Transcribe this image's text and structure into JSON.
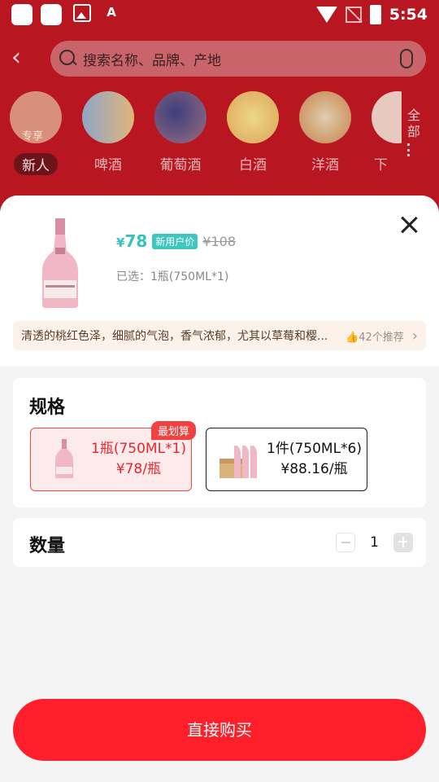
{
  "status_bar": {
    "time": "5:54"
  },
  "search": {
    "placeholder": "搜索名称、品牌、产地"
  },
  "categories": {
    "items": [
      {
        "label": "新人",
        "overlay": "专享",
        "active": true
      },
      {
        "label": "啤酒"
      },
      {
        "label": "葡萄酒"
      },
      {
        "label": "白酒"
      },
      {
        "label": "洋酒"
      },
      {
        "label": "下"
      }
    ],
    "all_label": "全部"
  },
  "sheet": {
    "price_symbol": "¥",
    "price_now": "78",
    "price_tag": "新用户价",
    "price_old": "¥108",
    "selected": "已选：1瓶(750ML*1)",
    "description": "清透的桃红色泽，细腻的气泡，香气浓郁，尤其以草莓和樱...",
    "recommend": "42个推荐",
    "spec_title": "规格",
    "best_badge": "最划算",
    "options": [
      {
        "name": "1瓶(750ML*1)",
        "price": "¥78/瓶",
        "selected": true
      },
      {
        "name": "1件(750ML*6)",
        "price": "¥88.16/瓶",
        "selected": false
      }
    ],
    "qty_title": "数量",
    "qty_value": "1",
    "buy_label": "直接购买"
  },
  "colors": {
    "accent": "#ff1f2a",
    "price": "#36c3b8",
    "bg_overlay": "#a8141f"
  }
}
